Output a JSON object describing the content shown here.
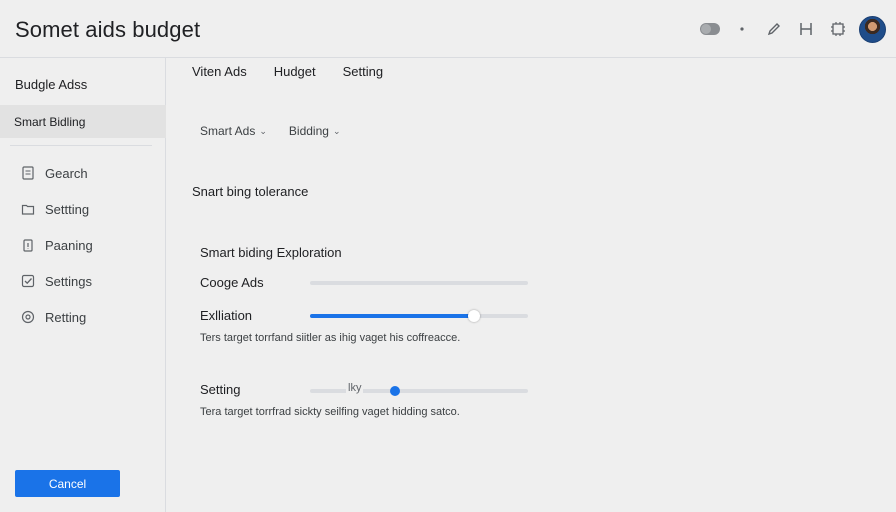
{
  "app": {
    "title": "Somet aids budget"
  },
  "topbar": {
    "icons": [
      "toggle-icon",
      "dot-icon",
      "edit-icon",
      "heading-icon",
      "chip-icon"
    ],
    "avatar": "user-avatar"
  },
  "sidebar": {
    "header": "Budgle Adss",
    "active": "Smart Bidling",
    "items": [
      {
        "label": "Gearch",
        "icon": "document-icon"
      },
      {
        "label": "Settting",
        "icon": "folder-icon"
      },
      {
        "label": "Paaning",
        "icon": "clipboard-icon"
      },
      {
        "label": "Settings",
        "icon": "checkbox-icon"
      },
      {
        "label": "Retting",
        "icon": "target-icon"
      }
    ],
    "cancel_label": "Cancel"
  },
  "main": {
    "tabs": [
      "Viten Ads",
      "Hudget",
      "Setting"
    ],
    "filters": [
      {
        "label": "Smart Ads",
        "chevron": "⌄"
      },
      {
        "label": "Bidding",
        "chevron": "⌄"
      }
    ],
    "section_title": "Snart bing tolerance",
    "panel": {
      "title": "Smart biding Exploration",
      "rows": [
        {
          "label": "Cooge Ads",
          "fill_fraction": 0.0
        },
        {
          "label": "Exlliation",
          "fill_fraction": 0.75
        }
      ],
      "help1": "Ters target torrfand siitler as ihig vaget his coffreacce.",
      "setting_row": {
        "label": "Setting",
        "track_text": "lky",
        "thumb_fraction": 0.39
      },
      "help2": "Tera target torrfrad sickty seilfing vaget hidding satco."
    }
  },
  "colors": {
    "accent": "#1a73e8",
    "background": "#efefef",
    "divider": "#dadce0"
  }
}
